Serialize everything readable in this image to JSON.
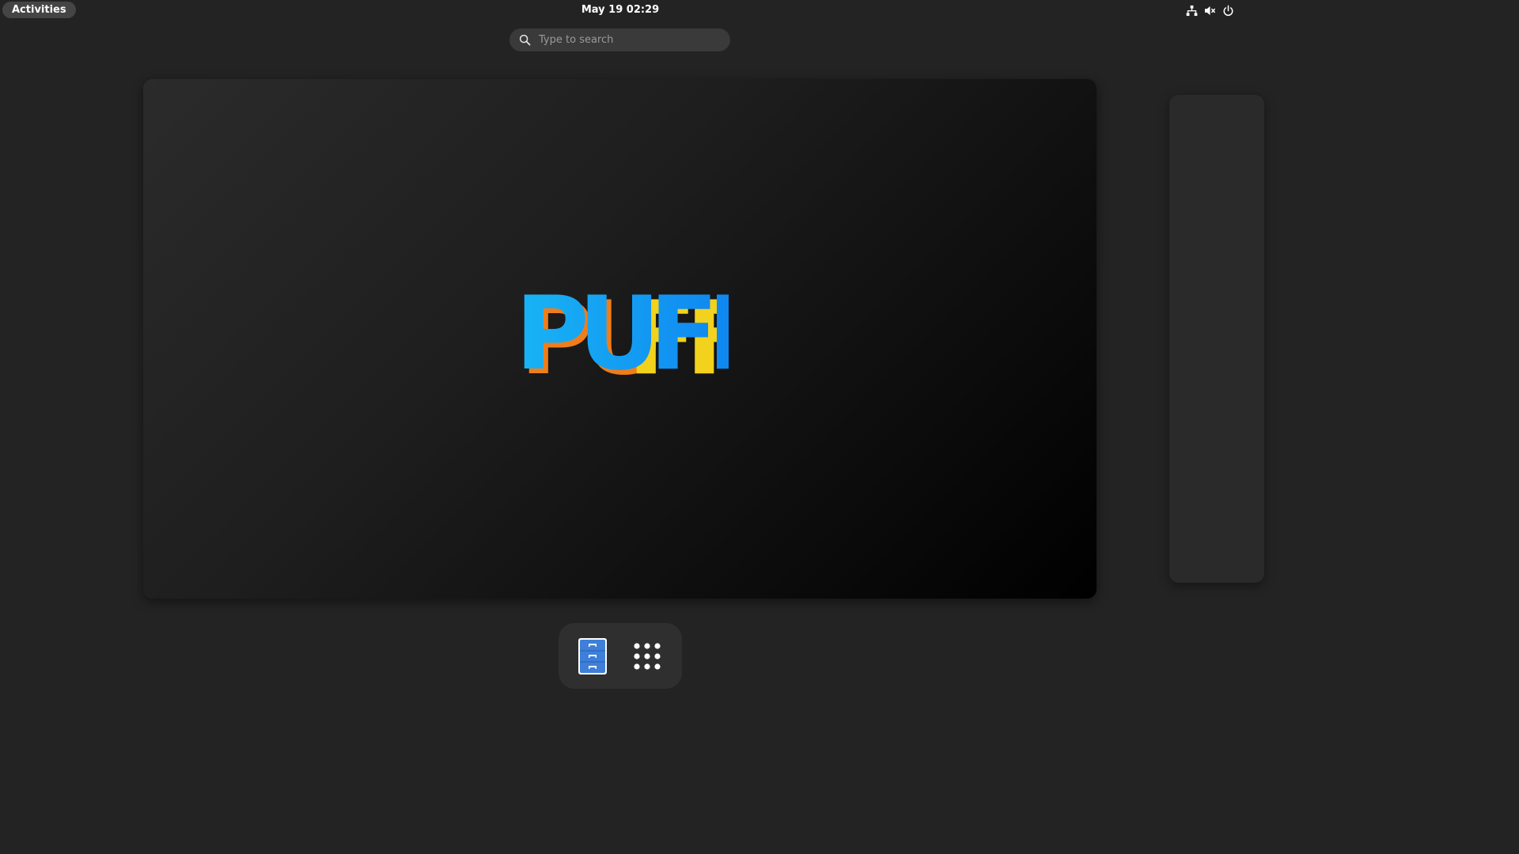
{
  "topbar": {
    "activities_label": "Activities",
    "clock": "May 19  02:29",
    "tray_icons": [
      "network-wired-icon",
      "audio-muted-icon",
      "power-icon"
    ]
  },
  "search": {
    "placeholder": "Type to search",
    "icon": "search-icon"
  },
  "workspace": {
    "wallpaper_text": "PUFF",
    "colors": {
      "logo_blue_light": "#19b4f4",
      "logo_blue_dark": "#0d7ef0",
      "logo_orange": "#f07d1a",
      "logo_yellow": "#f2d21c"
    }
  },
  "dash": {
    "apps": [
      {
        "name": "Files",
        "icon": "file-cabinet-icon",
        "color": "#3d7fd9"
      },
      {
        "name": "Show Applications",
        "icon": "app-grid-icon"
      }
    ]
  }
}
